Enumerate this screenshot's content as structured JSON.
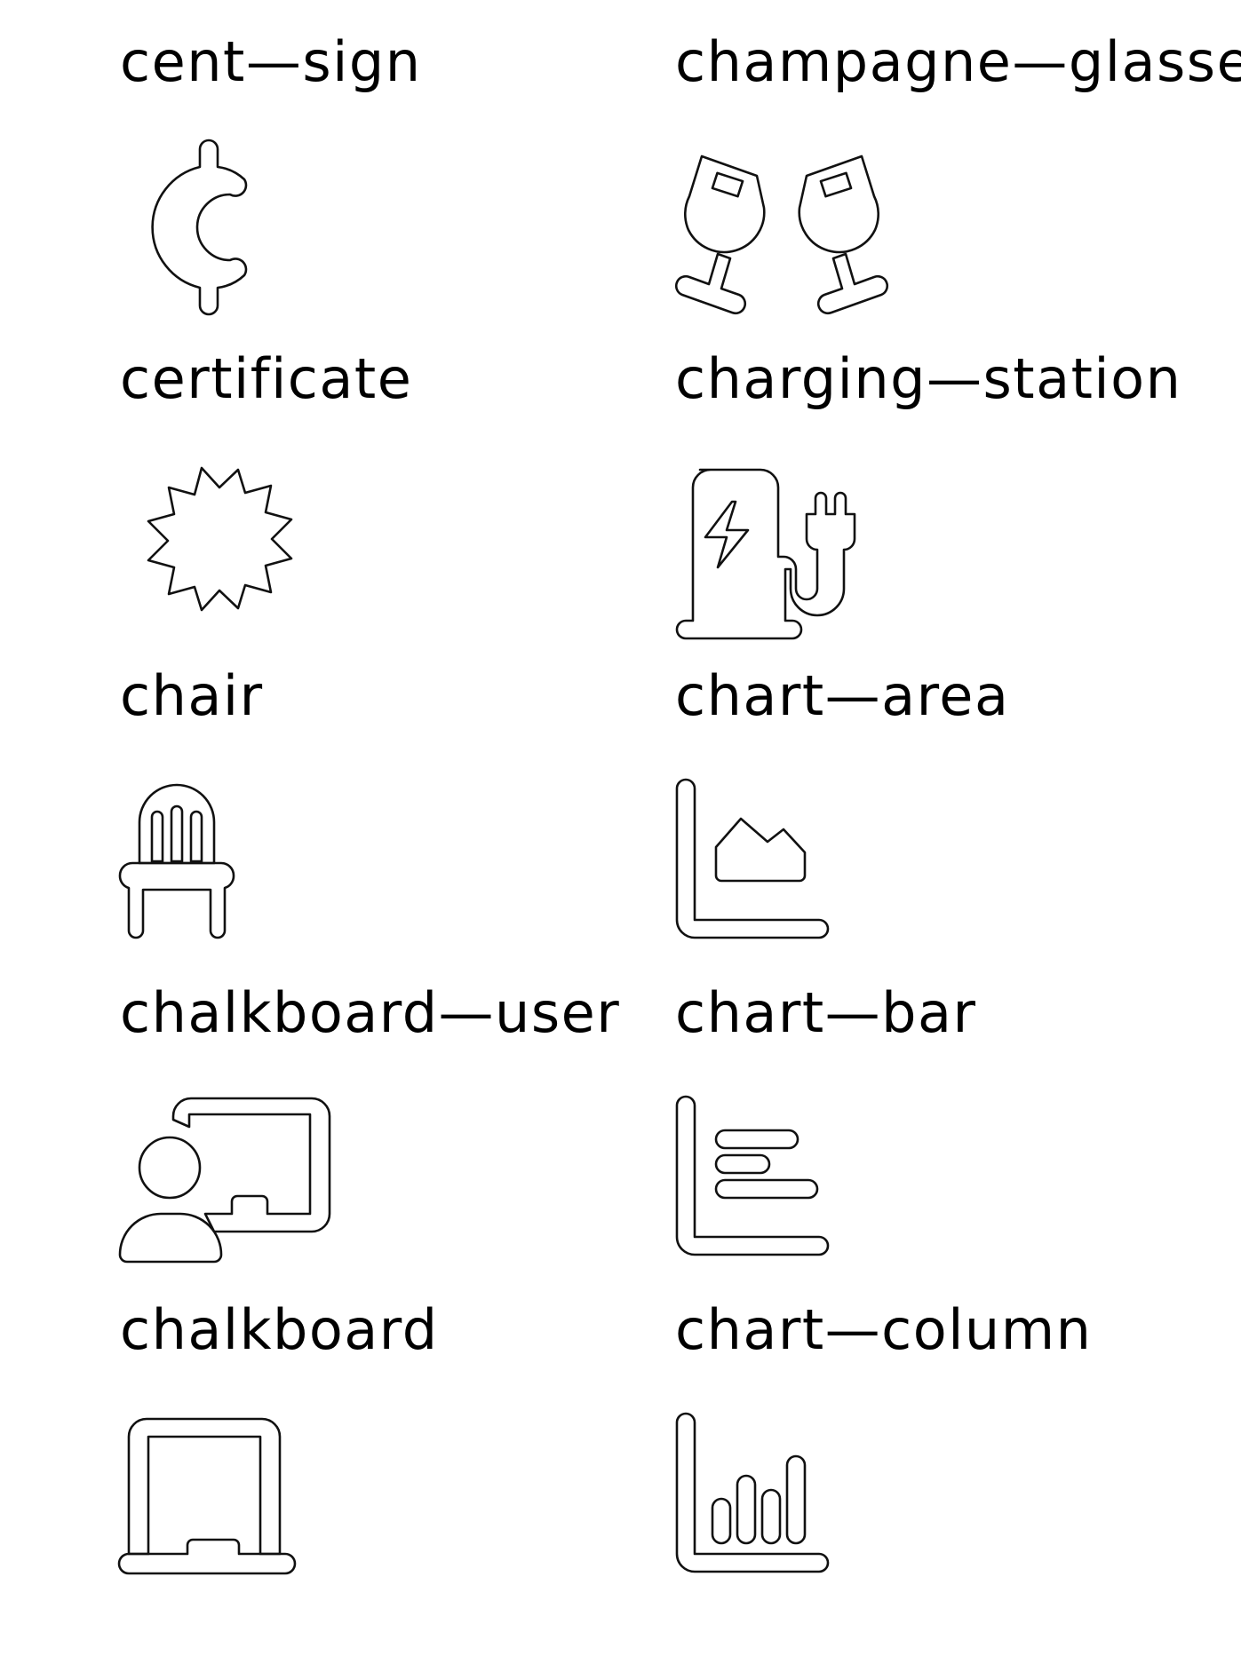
{
  "icons": [
    {
      "label": "cent—sign",
      "icon": "cent-sign-icon"
    },
    {
      "label": "champagne—glasses",
      "icon": "champagne-glasses-icon"
    },
    {
      "label": "certificate",
      "icon": "certificate-icon"
    },
    {
      "label": "charging—station",
      "icon": "charging-station-icon"
    },
    {
      "label": "chair",
      "icon": "chair-icon"
    },
    {
      "label": "chart—area",
      "icon": "chart-area-icon"
    },
    {
      "label": "chalkboard—user",
      "icon": "chalkboard-user-icon"
    },
    {
      "label": "chart—bar",
      "icon": "chart-bar-icon"
    },
    {
      "label": "chalkboard",
      "icon": "chalkboard-icon"
    },
    {
      "label": "chart—column",
      "icon": "chart-column-icon"
    }
  ]
}
